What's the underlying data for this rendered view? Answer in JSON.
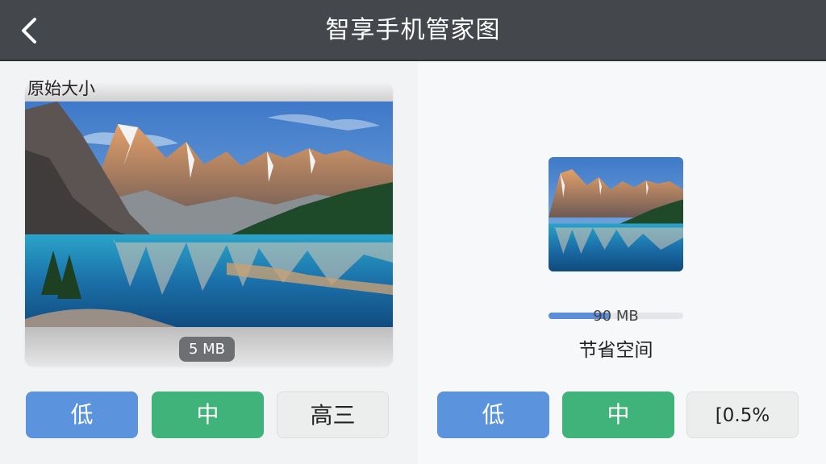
{
  "header": {
    "title": "智享手机管家图"
  },
  "original": {
    "label": "原始大小",
    "size": "5 MB"
  },
  "compressed": {
    "progress_text": "90 MB",
    "progress_fraction": 0.46,
    "saved_label": "节省空间"
  },
  "left_buttons": [
    {
      "label": "低",
      "color": "#5b93dc"
    },
    {
      "label": "中",
      "color": "#3fb37a"
    },
    {
      "label": "高三"
    }
  ],
  "right_buttons": [
    {
      "label": "低",
      "color": "#5b93dc"
    },
    {
      "label": "中",
      "color": "#3fb37a"
    },
    {
      "label": "[0.5%"
    }
  ],
  "icons": {
    "back": "chevron-left-icon"
  }
}
